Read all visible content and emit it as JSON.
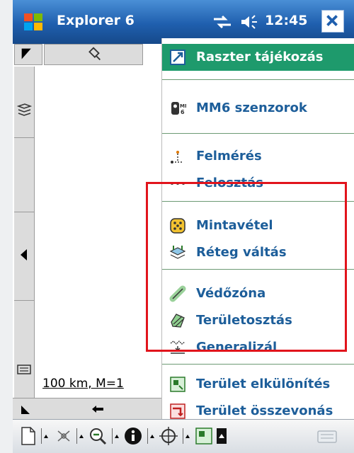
{
  "window": {
    "title": "Explorer 6",
    "clock": "12:45"
  },
  "map": {
    "scale_text": "100 km, M=1"
  },
  "menu": {
    "items": [
      {
        "label": "Raszter tájékozás",
        "icon": "raster-orient-icon",
        "highlighted": true
      },
      {
        "label": "MM6 szenzorok",
        "icon": "sensor-icon"
      },
      {
        "label": "Felmérés",
        "icon": "survey-icon"
      },
      {
        "label": "Felosztás",
        "icon": "division-icon"
      },
      {
        "label": "Mintavétel",
        "icon": "sampling-icon"
      },
      {
        "label": "Réteg váltás",
        "icon": "layer-switch-icon"
      },
      {
        "label": "Védőzóna",
        "icon": "buffer-zone-icon"
      },
      {
        "label": "Területosztás",
        "icon": "area-split-icon"
      },
      {
        "label": "Generalizál",
        "icon": "generalize-icon"
      },
      {
        "label": "Terület elkülönítés",
        "icon": "area-separate-icon"
      },
      {
        "label": "Terület összevonás",
        "icon": "area-merge-icon"
      }
    ]
  },
  "colors": {
    "highlight": "#1e9a6c",
    "menu_text": "#1d5e9a",
    "annotation": "#e1141c"
  }
}
